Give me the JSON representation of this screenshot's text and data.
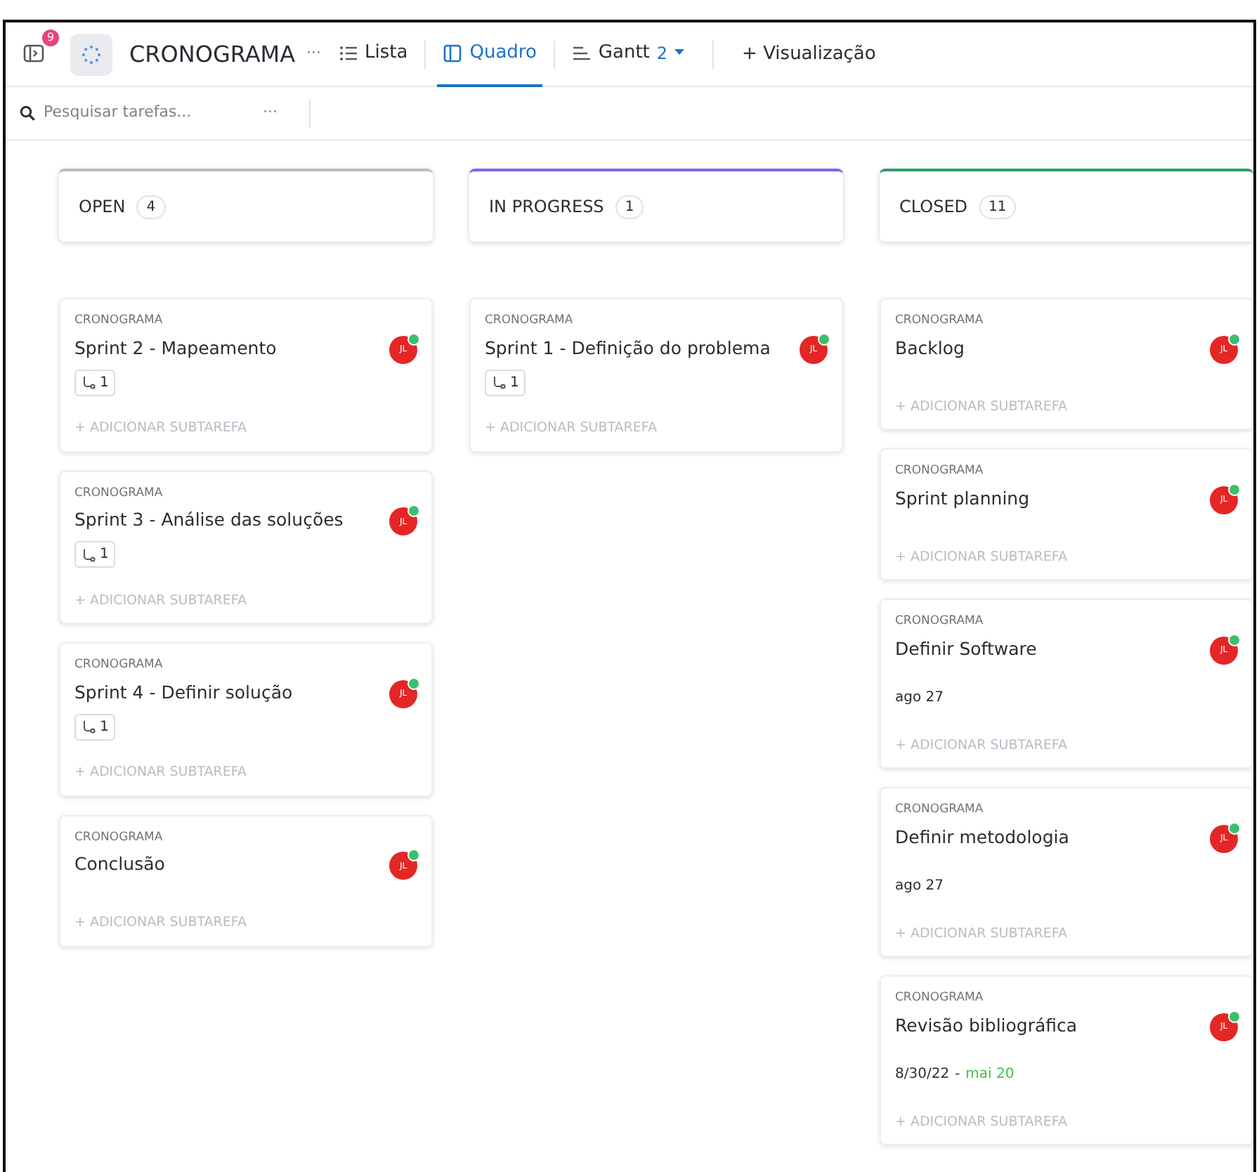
{
  "header": {
    "sidebar_badge": "9",
    "space_title": "CRONOGRAMA",
    "more": "···",
    "views": [
      {
        "kind": "list",
        "label": "Lista",
        "selected": false
      },
      {
        "kind": "board",
        "label": "Quadro",
        "selected": true
      },
      {
        "kind": "gantt",
        "label": "Gantt",
        "count": "2",
        "selected": false
      }
    ],
    "add_view": "+ Visualização"
  },
  "toolbar": {
    "search": {
      "placeholder": "Pesquisar tarefas..."
    },
    "more": "···"
  },
  "columns": [
    {
      "name": "OPEN",
      "count": "4",
      "color": "#b9bcc4",
      "cards": [
        {
          "project": "CRONOGRAMA",
          "title": "Sprint 2 - Mapeamento",
          "avatar": "JL",
          "subtasks": "1",
          "add": "+ ADICIONAR SUBTAREFA"
        },
        {
          "project": "CRONOGRAMA",
          "title": "Sprint 3 - Análise das soluções",
          "avatar": "JL",
          "subtasks": "1",
          "add": "+ ADICIONAR SUBTAREFA"
        },
        {
          "project": "CRONOGRAMA",
          "title": "Sprint 4 - Definir solução",
          "avatar": "JL",
          "subtasks": "1",
          "add": "+ ADICIONAR SUBTAREFA"
        },
        {
          "project": "CRONOGRAMA",
          "title": "Conclusão",
          "avatar": "JL",
          "add": "+ ADICIONAR SUBTAREFA"
        }
      ]
    },
    {
      "name": "IN PROGRESS",
      "count": "1",
      "color": "#7b68ee",
      "cards": [
        {
          "project": "CRONOGRAMA",
          "title": "Sprint 1 - Definição do problema",
          "avatar": "JL",
          "subtasks": "1",
          "add": "+ ADICIONAR SUBTAREFA"
        }
      ]
    },
    {
      "name": "CLOSED",
      "count": "11",
      "color": "#2e9e6a",
      "cards": [
        {
          "project": "CRONOGRAMA",
          "title": "Backlog",
          "avatar": "JL",
          "add": "+ ADICIONAR SUBTAREFA"
        },
        {
          "project": "CRONOGRAMA",
          "title": "Sprint planning",
          "avatar": "JL",
          "add": "+ ADICIONAR SUBTAREFA"
        },
        {
          "project": "CRONOGRAMA",
          "title": "Definir Software",
          "avatar": "JL",
          "date": "ago 27",
          "add": "+ ADICIONAR SUBTAREFA"
        },
        {
          "project": "CRONOGRAMA",
          "title": "Definir metodologia",
          "avatar": "JL",
          "date": "ago 27",
          "add": "+ ADICIONAR SUBTAREFA"
        },
        {
          "project": "CRONOGRAMA",
          "title": "Revisão bibliográfica",
          "avatar": "JL",
          "date": "8/30/22",
          "date_sep": "-",
          "due": "mai 20",
          "add": "+ ADICIONAR SUBTAREFA"
        }
      ]
    }
  ]
}
